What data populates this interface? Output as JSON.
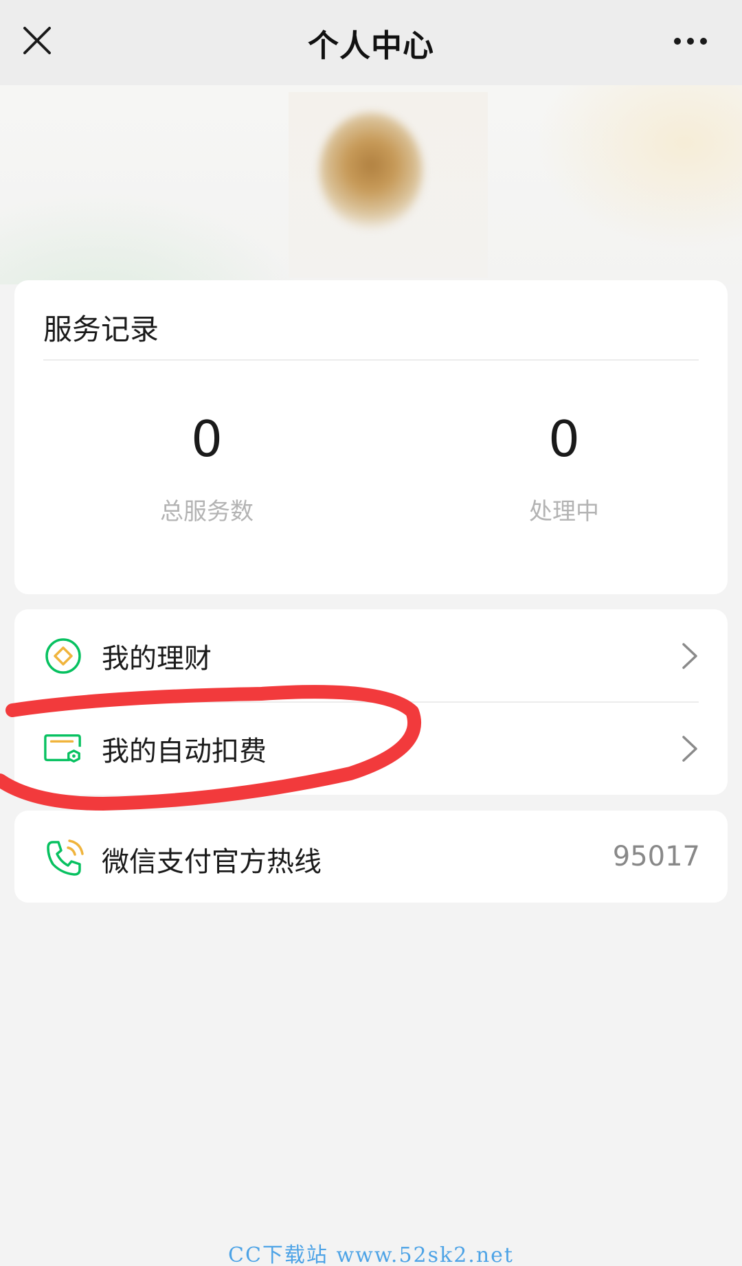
{
  "header": {
    "title": "个人中心"
  },
  "icons": {
    "close": "close-icon",
    "more": "more-dots-icon",
    "finance": "finance-diamond-icon",
    "autopay": "autopay-card-icon",
    "hotline": "phone-call-icon",
    "chevron": "chevron-right-icon"
  },
  "colors": {
    "accent_green": "#07c160",
    "accent_yellow": "#f0b43c",
    "annotation_red": "#f23a3c",
    "watermark_blue": "#4da3e6"
  },
  "service_records": {
    "title": "服务记录",
    "stats": [
      {
        "value": "0",
        "label": "总服务数"
      },
      {
        "value": "0",
        "label": "处理中"
      }
    ]
  },
  "menu": {
    "items": [
      {
        "label": "我的理财"
      },
      {
        "label": "我的自动扣费"
      }
    ]
  },
  "hotline": {
    "label": "微信支付官方热线",
    "number": "95017"
  },
  "watermark": {
    "text": "CC下载站 www.52sk2.net"
  }
}
